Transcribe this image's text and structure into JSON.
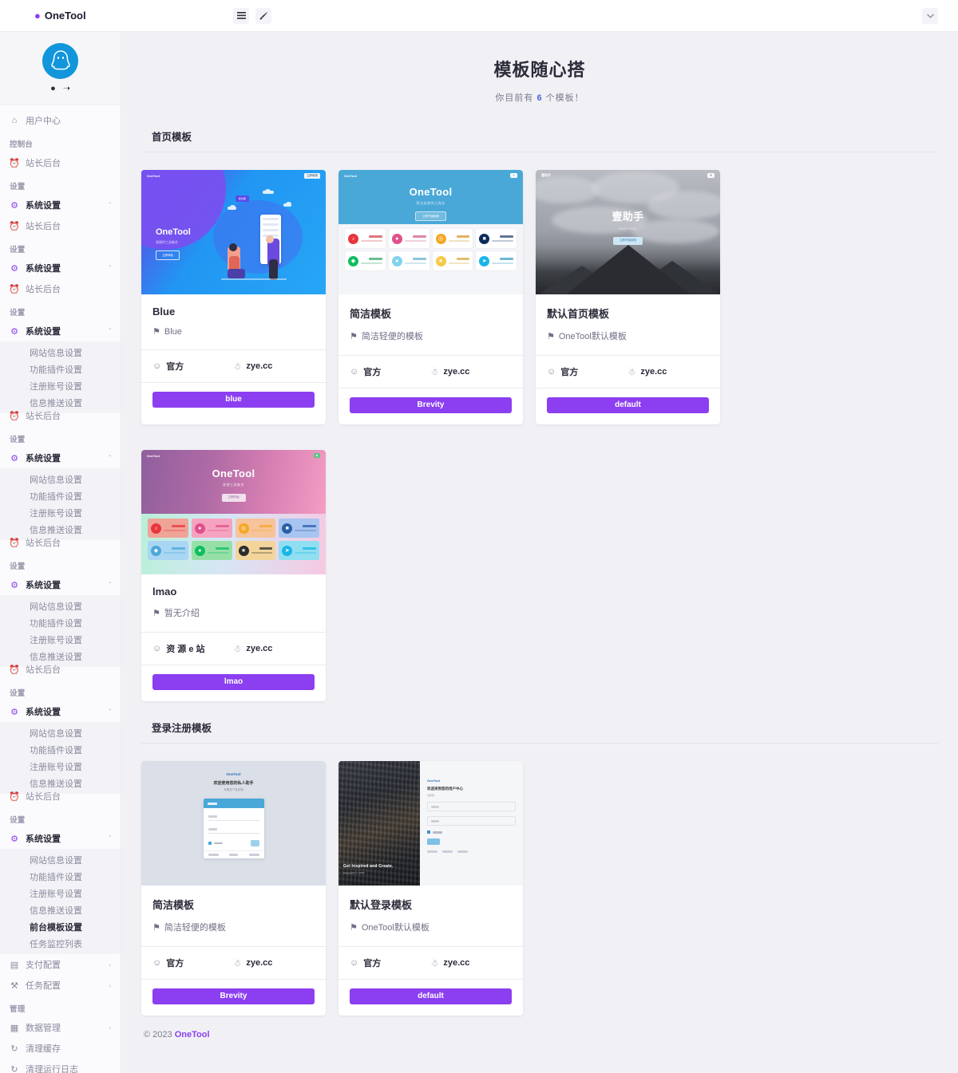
{
  "topbar": {
    "brand": "OneTool",
    "brand_icon": "droplet-icon",
    "menu_toggle_icon": "hamburger-menu-icon",
    "theme_icon": "paint-brush-icon",
    "user_dropdown_icon": "chevron-down-icon"
  },
  "sidebar": {
    "avatar_icon": "qq-penguin-avatar",
    "profile_actions": [
      {
        "name": "theme-droplet",
        "glyph": "●"
      },
      {
        "name": "logout",
        "glyph": "→"
      }
    ],
    "user_center": "用户中心",
    "groups": [
      {
        "title": "控制台",
        "items": [
          {
            "label": "站长后台",
            "icon": "dashboard-icon"
          }
        ]
      },
      {
        "title": "设置",
        "items": [
          {
            "label": "系统设置",
            "icon": "gear-icon",
            "bold": true,
            "caret": "ˇ"
          },
          {
            "label": "站长后台",
            "icon": "dashboard-icon"
          }
        ]
      },
      {
        "title": "设置",
        "items": [
          {
            "label": "系统设置",
            "icon": "gear-icon",
            "bold": true,
            "caret": "ˇ"
          },
          {
            "label": "站长后台",
            "icon": "dashboard-icon"
          }
        ]
      },
      {
        "title": "设置",
        "items": [
          {
            "label": "系统设置",
            "icon": "gear-icon",
            "bold": true,
            "caret": "ˇ"
          }
        ],
        "sub": [
          "网站信息设置",
          "功能插件设置",
          "注册账号设置",
          "信息推送设置"
        ],
        "after": {
          "label": "站长后台",
          "icon": "dashboard-icon"
        }
      },
      {
        "title": "设置",
        "items": [
          {
            "label": "系统设置",
            "icon": "gear-icon",
            "bold": true,
            "caret": "ˇ"
          }
        ],
        "sub": [
          "网站信息设置",
          "功能插件设置",
          "注册账号设置",
          "信息推送设置"
        ],
        "after": {
          "label": "站长后台",
          "icon": "dashboard-icon"
        }
      },
      {
        "title": "设置",
        "items": [
          {
            "label": "系统设置",
            "icon": "gear-icon",
            "bold": true,
            "caret": "ˇ"
          }
        ],
        "sub": [
          "网站信息设置",
          "功能插件设置",
          "注册账号设置",
          "信息推送设置"
        ],
        "after": {
          "label": "站长后台",
          "icon": "dashboard-icon"
        }
      },
      {
        "title": "设置",
        "items": [
          {
            "label": "系统设置",
            "icon": "gear-icon",
            "bold": true,
            "caret": "ˇ"
          }
        ],
        "sub": [
          "网站信息设置",
          "功能插件设置",
          "注册账号设置",
          "信息推送设置"
        ],
        "after": {
          "label": "站长后台",
          "icon": "dashboard-icon"
        }
      },
      {
        "title": "设置",
        "items": [
          {
            "label": "系统设置",
            "icon": "gear-icon",
            "bold": true,
            "caret": "ˇ"
          }
        ],
        "sub": [
          "网站信息设置",
          "功能插件设置",
          "注册账号设置",
          "信息推送设置",
          "前台模板设置",
          "任务监控列表"
        ],
        "active_sub": "前台模板设置"
      }
    ],
    "pay_config": {
      "label": "支付配置",
      "icon": "credit-card-icon",
      "caret": "‹"
    },
    "task_config": {
      "label": "任务配置",
      "icon": "tasks-icon",
      "caret": "‹"
    },
    "manage_title": "管理",
    "data_manage": {
      "label": "数据管理",
      "icon": "bar-chart-icon",
      "caret": "‹"
    },
    "clear_cache": {
      "label": "清理缓存",
      "icon": "refresh-icon"
    },
    "clear_logs": {
      "label": "清理运行日志",
      "icon": "refresh-icon"
    }
  },
  "page": {
    "title": "模板随心搭",
    "subtitle_prefix": "你目前有",
    "subtitle_count": "6",
    "subtitle_suffix": "个模板！"
  },
  "sections": [
    {
      "heading": "首页模板"
    },
    {
      "heading": "登录注册模板"
    }
  ],
  "home_templates": [
    {
      "name": "Blue",
      "desc": "Blue",
      "author": "官方",
      "site": "zye.cc",
      "button": "blue",
      "thumb": "blue-illustration",
      "thumb_brand": "OneTool",
      "thumb_pill": "立即使用",
      "hero_title": "OneTool",
      "hero_sub": "便捷的工具集合",
      "hero_cta": "立即体验",
      "chip": "新功能"
    },
    {
      "name": "简洁模板",
      "desc": "简洁轻便的模板",
      "author": "官方",
      "site": "zye.cc",
      "button": "Brevity",
      "thumb": "brevity-icon-grid",
      "thumb_brand": "OneTool",
      "hero_title": "OneTool",
      "hero_sub": "简洁轻便的工具站",
      "hero_cta": "立即开始使用"
    },
    {
      "name": "默认首页模板",
      "desc": "OneTool默认模板",
      "author": "官方",
      "site": "zye.cc",
      "button": "default",
      "thumb": "mountain-photo",
      "thumb_brand": "壹助手",
      "hero_title": "壹助手",
      "hero_sub": "ONETOOL",
      "hero_cta": "立即开始使用"
    },
    {
      "name": "lmao",
      "desc": "暂无介绍",
      "author": "资 源 e 站",
      "site": "zye.cc",
      "button": "lmao",
      "thumb": "lmao-gradient-grid",
      "thumb_brand": "OneTool",
      "hero_title": "OneTool",
      "hero_sub": "便捷工具集合",
      "hero_cta": "立即开始"
    }
  ],
  "login_templates": [
    {
      "name": "简洁模板",
      "desc": "简洁轻便的模板",
      "author": "官方",
      "site": "zye.cc",
      "button": "Brevity",
      "thumb": "brevity-login-form",
      "thumb_brand": "OneTool",
      "thumb_title": "欢迎使用您的私人助手",
      "thumb_sub": "专属您个性定制"
    },
    {
      "name": "默认登录模板",
      "desc": "OneTool默认模板",
      "author": "官方",
      "site": "zye.cc",
      "button": "default",
      "thumb": "city-photo-login",
      "thumb_brand": "OneTool",
      "thumb_title": "欢迎来到您的用户中心",
      "thumb_sub": "请登录",
      "photo_caption": "Get Inspired and Create.",
      "photo_sub": "Copyright © 2023"
    }
  ],
  "icon_grid_brevity": [
    {
      "color": "#e8353e",
      "glyph": "♪",
      "tint": "#d04a52"
    },
    {
      "color": "#e0508a",
      "glyph": "●",
      "tint": "#cf5f8f"
    },
    {
      "color": "#f5a623",
      "glyph": "◎",
      "tint": "#d8962f"
    },
    {
      "color": "#0b2d5c",
      "glyph": "■",
      "tint": "#2f4a73"
    },
    {
      "color": "#0fbf5f",
      "glyph": "◆",
      "tint": "#3aa86a"
    },
    {
      "color": "#7fd3ef",
      "glyph": "●",
      "tint": "#69b0ca"
    },
    {
      "color": "#f7c948",
      "glyph": "★",
      "tint": "#d4aa3d"
    },
    {
      "color": "#19b5e8",
      "glyph": "➤",
      "tint": "#3f9fc4"
    }
  ],
  "icon_grid_lmao": [
    {
      "bg": "#f0a397",
      "color": "#e8353e",
      "glyph": "♪"
    },
    {
      "bg": "#f5a3c0",
      "color": "#e0508a",
      "glyph": "●"
    },
    {
      "bg": "#f7c39a",
      "color": "#f5a623",
      "glyph": "◎"
    },
    {
      "bg": "#a8c4f0",
      "color": "#2a5fa8",
      "glyph": "■"
    },
    {
      "bg": "#a9d6f2",
      "color": "#4aa8d8",
      "glyph": "◆"
    },
    {
      "bg": "#96e0a8",
      "color": "#0fbf5f",
      "glyph": "●"
    },
    {
      "bg": "#f3d49a",
      "color": "#2b2b2b",
      "glyph": "★"
    },
    {
      "bg": "#8fdff0",
      "color": "#19b5e8",
      "glyph": "➤"
    }
  ],
  "icons": {
    "location_pin": "⚑",
    "user": "☺",
    "tux": "⛄"
  },
  "footer": {
    "copyright": "© 2023",
    "brand": "OneTool"
  },
  "colors": {
    "accent": "#8b3ff0",
    "link": "#4a63d8",
    "page_bg": "#f1f1f5",
    "sidebar_bg": "#fbfbfd"
  }
}
